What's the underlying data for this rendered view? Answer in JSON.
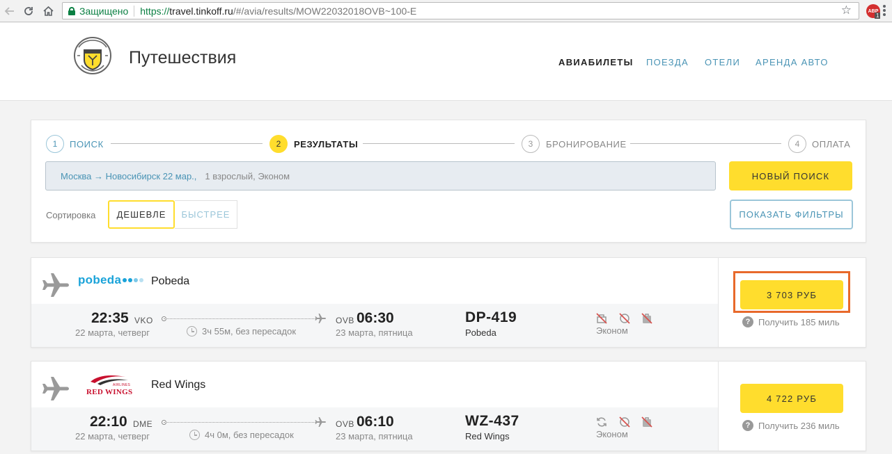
{
  "browser": {
    "secure_label": "Защищено",
    "url_proto": "https://",
    "url_host": "travel.tinkoff.ru",
    "url_path": "/#/avia/results/MOW22032018OVB~100-E",
    "ext_label": "ABP",
    "ext_badge": "1"
  },
  "header": {
    "brand": "Путешествия",
    "nav": [
      "АВИАБИЛЕТЫ",
      "ПОЕЗДА",
      "ОТЕЛИ",
      "АРЕНДА АВТО"
    ],
    "active_nav": "АВИАБИЛЕТЫ"
  },
  "steps": [
    {
      "num": "1",
      "label": "ПОИСК"
    },
    {
      "num": "2",
      "label": "РЕЗУЛЬТАТЫ"
    },
    {
      "num": "3",
      "label": "БРОНИРОВАНИЕ"
    },
    {
      "num": "4",
      "label": "ОПЛАТА"
    }
  ],
  "current_step": 2,
  "search": {
    "route": "Москва → Новосибирск 22 мар.,",
    "passengers": "1 взрослый, Эконом",
    "new_search": "НОВЫЙ ПОИСК"
  },
  "sort": {
    "label": "Сортировка",
    "cheaper": "ДЕШЕВЛЕ",
    "faster": "БЫСТРЕЕ",
    "filters": "ПОКАЗАТЬ ФИЛЬТРЫ"
  },
  "results": [
    {
      "airline": "Pobeda",
      "logo_text": "pobeda",
      "dep_time": "22:35",
      "dep_airport": "VKO",
      "dep_date": "22 марта, четверг",
      "duration": "3ч 55м, без пересадок",
      "arr_airport": "OVB",
      "arr_time": "06:30",
      "arr_date": "23 марта, пятница",
      "flight": "DP-419",
      "carrier": "Pobeda",
      "class": "Эконом",
      "price": "3 703 РУБ",
      "miles": "Получить 185 миль",
      "amenity_icons": [
        "no-baggage-icon",
        "no-meal-icon",
        "no-luggage-icon"
      ]
    },
    {
      "airline": "Red Wings",
      "logo_text": "RED WINGS",
      "logo_sub": "AIRLINES",
      "dep_time": "22:10",
      "dep_airport": "DME",
      "dep_date": "22 марта, четверг",
      "duration": "4ч 0м, без пересадок",
      "arr_airport": "OVB",
      "arr_time": "06:10",
      "arr_date": "23 марта, пятница",
      "flight": "WZ-437",
      "carrier": "Red Wings",
      "class": "Эконом",
      "price": "4 722 РУБ",
      "miles": "Получить 236 миль",
      "amenity_icons": [
        "exchange-icon",
        "no-meal-icon",
        "no-luggage-icon"
      ]
    }
  ],
  "colors": {
    "accent_yellow": "#ffdd2d",
    "link_blue": "#4a94b5",
    "pobeda_blue": "#1aa3d9",
    "redwings_red": "#c8102e",
    "highlight_orange": "#e8692b"
  }
}
